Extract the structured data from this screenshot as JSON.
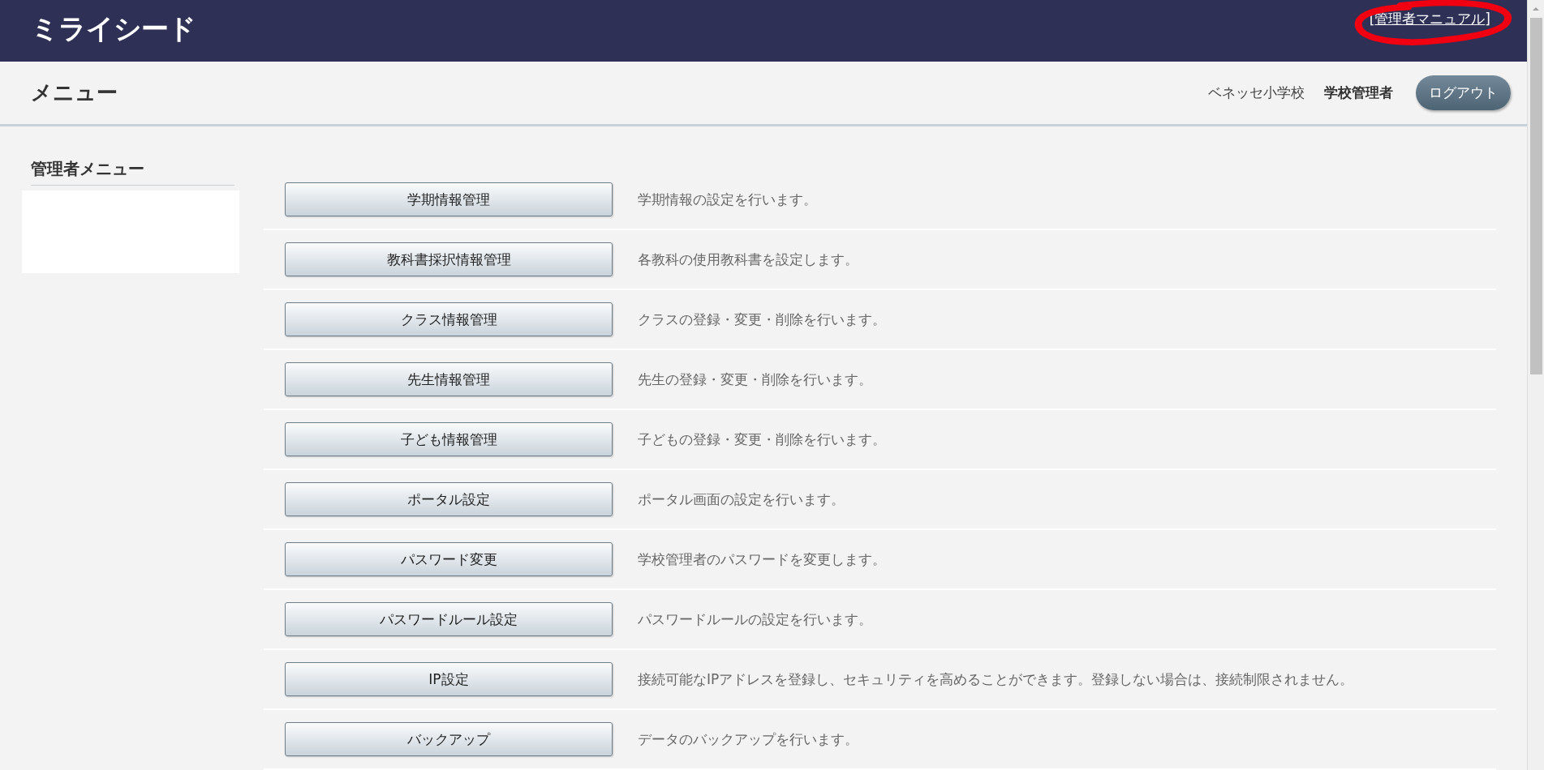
{
  "header": {
    "logo": "ミライシード",
    "manual_link": "管理者マニュアル",
    "manual_brackets": [
      "[",
      "]"
    ],
    "annotation": true
  },
  "page_bar": {
    "title": "メニュー",
    "school": "ベネッセ小学校",
    "role": "学校管理者",
    "logout": "ログアウト"
  },
  "sidebar": {
    "heading": "管理者メニュー"
  },
  "menu": [
    {
      "button": "学期情報管理",
      "description": "学期情報の設定を行います。"
    },
    {
      "button": "教科書採択情報管理",
      "description": "各教科の使用教科書を設定します。"
    },
    {
      "button": "クラス情報管理",
      "description": "クラスの登録・変更・削除を行います。"
    },
    {
      "button": "先生情報管理",
      "description": "先生の登録・変更・削除を行います。"
    },
    {
      "button": "子ども情報管理",
      "description": "子どもの登録・変更・削除を行います。"
    },
    {
      "button": "ポータル設定",
      "description": "ポータル画面の設定を行います。"
    },
    {
      "button": "パスワード変更",
      "description": "学校管理者のパスワードを変更します。"
    },
    {
      "button": "パスワードルール設定",
      "description": "パスワードルールの設定を行います。"
    },
    {
      "button": "IP設定",
      "description": "接続可能なIPアドレスを登録し、セキュリティを高めることができます。登録しない場合は、接続制限されません。"
    },
    {
      "button": "バックアップ",
      "description": "データのバックアップを行います。"
    }
  ]
}
